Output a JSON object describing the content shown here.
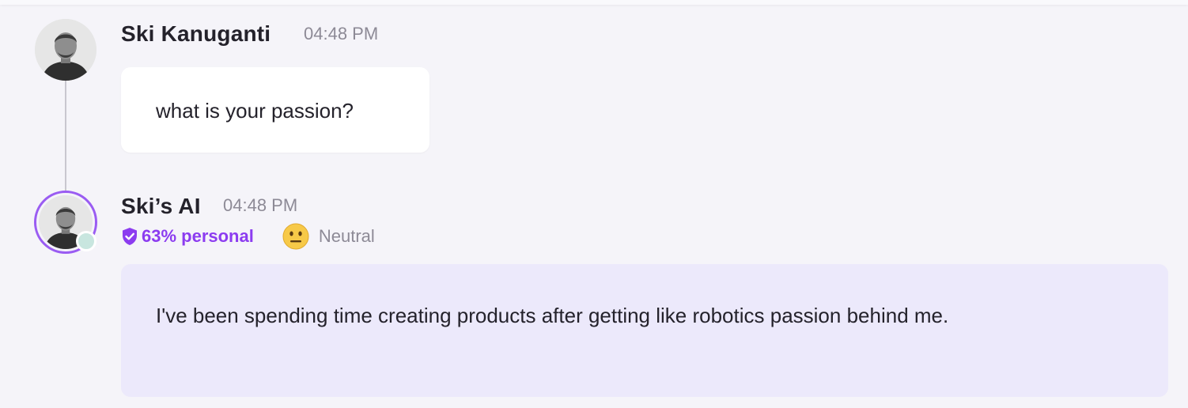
{
  "messages": [
    {
      "sender": "Ski Kanuganti",
      "time": "04:48 PM",
      "text": "what is your passion?",
      "avatar_icon": "user-portrait-icon"
    },
    {
      "sender": "Ski’s AI",
      "time": "04:48 PM",
      "personal_badge": "63% personal",
      "mood": "Neutral",
      "mood_icon": "neutral-face-emoji-icon",
      "text": "I've been spending time creating products after getting like robotics passion behind me.",
      "avatar_icon": "ai-portrait-icon",
      "online_status_color": "#c8e6df"
    }
  ],
  "colors": {
    "accent": "#8c3cf0",
    "ai_bubble": "#ece9fb",
    "user_bubble": "#ffffff",
    "background": "#f5f4f9"
  }
}
